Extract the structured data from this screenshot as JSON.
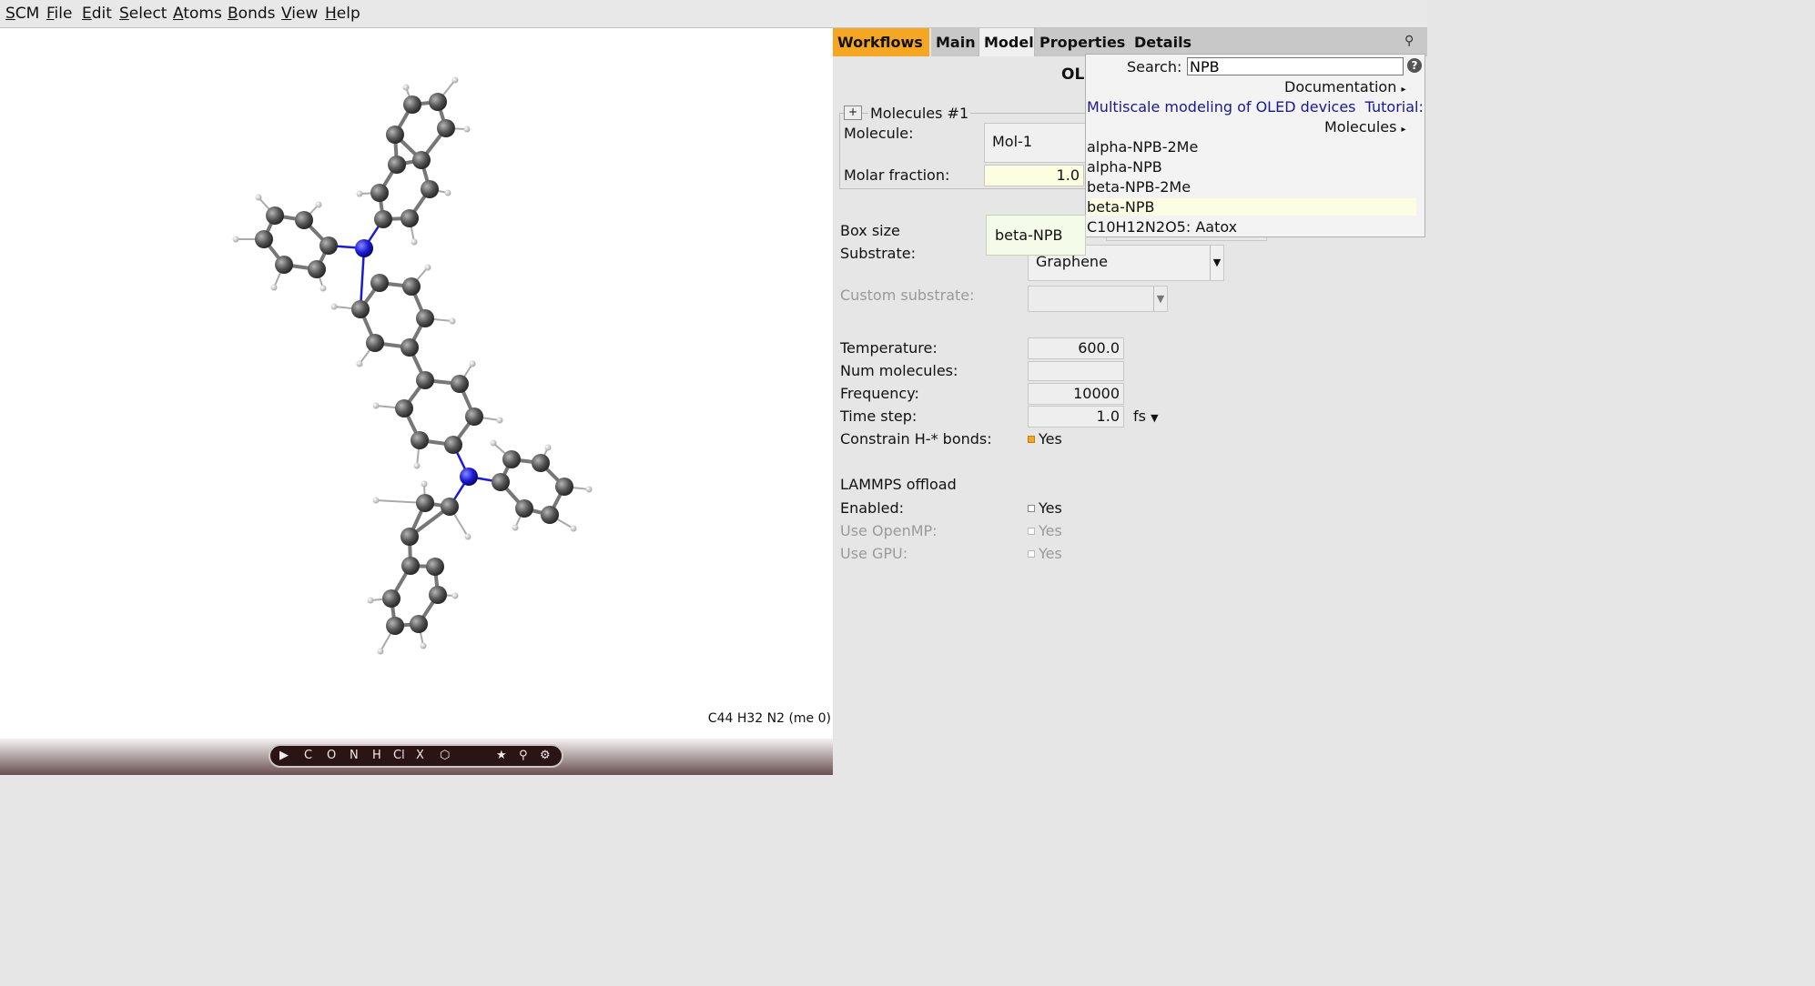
{
  "menubar": {
    "items": [
      "SCM",
      "File",
      "Edit",
      "Select",
      "Atoms",
      "Bonds",
      "View",
      "Help"
    ]
  },
  "viewer": {
    "formula": "C44 H32 N2  (me 0)"
  },
  "toolbar": {
    "tools": [
      "C",
      "O",
      "N",
      "H",
      "Cl",
      "X",
      "★"
    ]
  },
  "tabs": {
    "workflows": "Workflows",
    "main": "Main",
    "model": "Model",
    "properties": "Properties",
    "details": "Details"
  },
  "panel": {
    "title_partial": "OL",
    "molecules_group": "Molecules #1",
    "molecule_label": "Molecule:",
    "molecule_value": "Mol-1",
    "molar_fraction_label": "Molar fraction:",
    "molar_fraction_value": "1.0",
    "box_size_label": "Box size",
    "substrate_label": "Substrate:",
    "substrate_value": "Graphene",
    "custom_substrate_label": "Custom substrate:",
    "temperature_label": "Temperature:",
    "temperature_value": "600.0",
    "num_molecules_label": "Num molecules:",
    "num_molecules_value": "",
    "frequency_label": "Frequency:",
    "frequency_value": "10000",
    "time_step_label": "Time step:",
    "time_step_value": "1.0",
    "time_step_unit": "fs",
    "constrain_label": "Constrain H-* bonds:",
    "constrain_value": "Yes",
    "lammps_header": "LAMMPS offload",
    "enabled_label": "Enabled:",
    "enabled_value": "Yes",
    "openmp_label": "Use OpenMP:",
    "openmp_value": "Yes",
    "gpu_label": "Use GPU:",
    "gpu_value": "Yes"
  },
  "search": {
    "label": "Search:",
    "query": "NPB",
    "documentation": "Documentation",
    "doc_result": "Multiscale modeling of OLED devices",
    "doc_result_tag": "Tutorial:",
    "molecules_header": "Molecules",
    "results": [
      "alpha-NPB-2Me",
      "alpha-NPB",
      "beta-NPB-2Me",
      "beta-NPB",
      "C10H12N2O5: Aatox"
    ],
    "highlighted_index": 3
  },
  "tooltip": {
    "text": "beta-NPB"
  },
  "colors": {
    "workflows_tab": "#f5a623",
    "highlight": "#fdfde4",
    "link": "#1a1a8c",
    "nitrogen": "#1b1bd6",
    "carbon": "#555555"
  }
}
